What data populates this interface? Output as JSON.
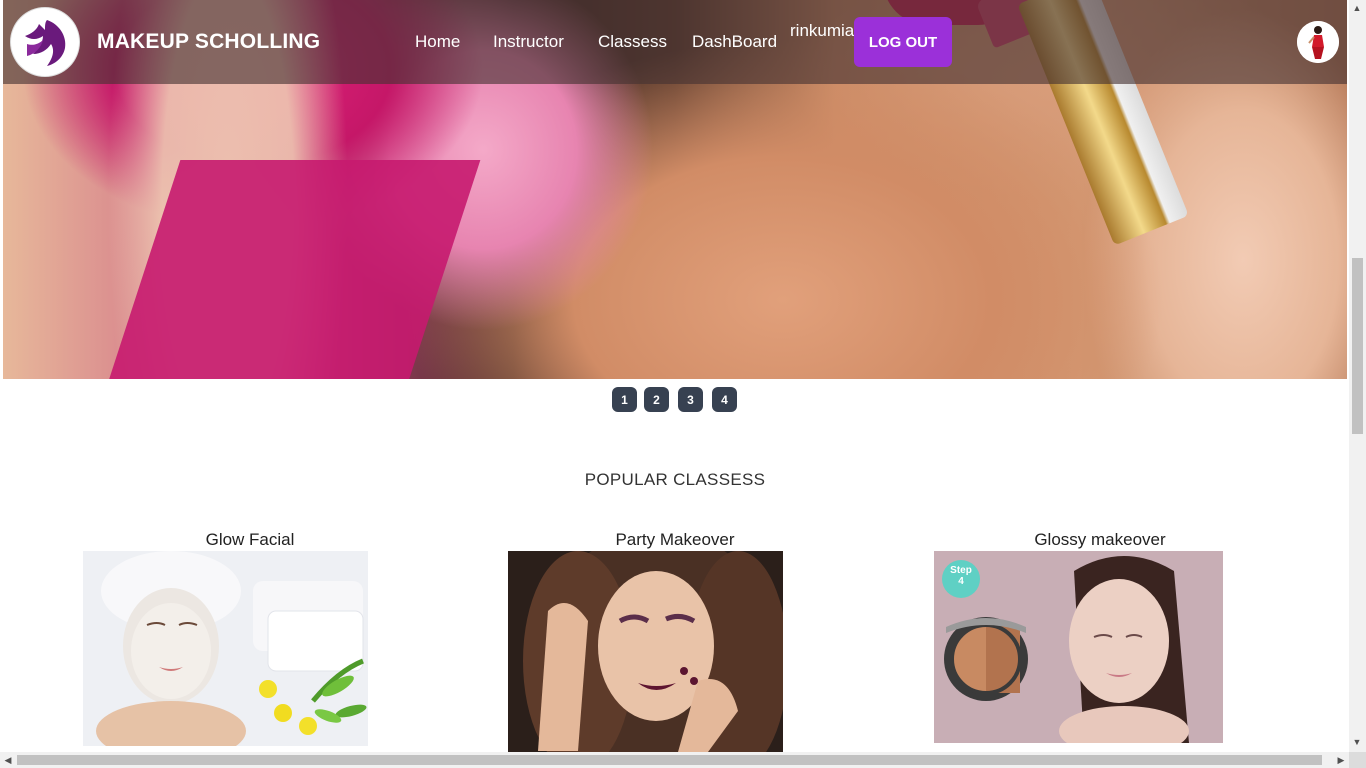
{
  "brand": {
    "name": "MAKEUP SCHOLLING"
  },
  "nav": {
    "links": [
      "Home",
      "Instructor",
      "Classess",
      "DashBoard"
    ],
    "username": "rinkumia",
    "logout_label": "LOG OUT"
  },
  "carousel": {
    "indicators": [
      "1",
      "2",
      "3",
      "4"
    ]
  },
  "popular": {
    "title": "POPULAR CLASSESS",
    "classes": [
      {
        "name": "Glow Facial"
      },
      {
        "name": "Party Makeover"
      },
      {
        "name": "Glossy makeover",
        "badge_top": "Step",
        "badge_bottom": "4"
      }
    ]
  },
  "colors": {
    "accent": "#9b30d9",
    "indicator": "#374151",
    "navbar_overlay": "rgba(70,50,50,0.62)"
  }
}
